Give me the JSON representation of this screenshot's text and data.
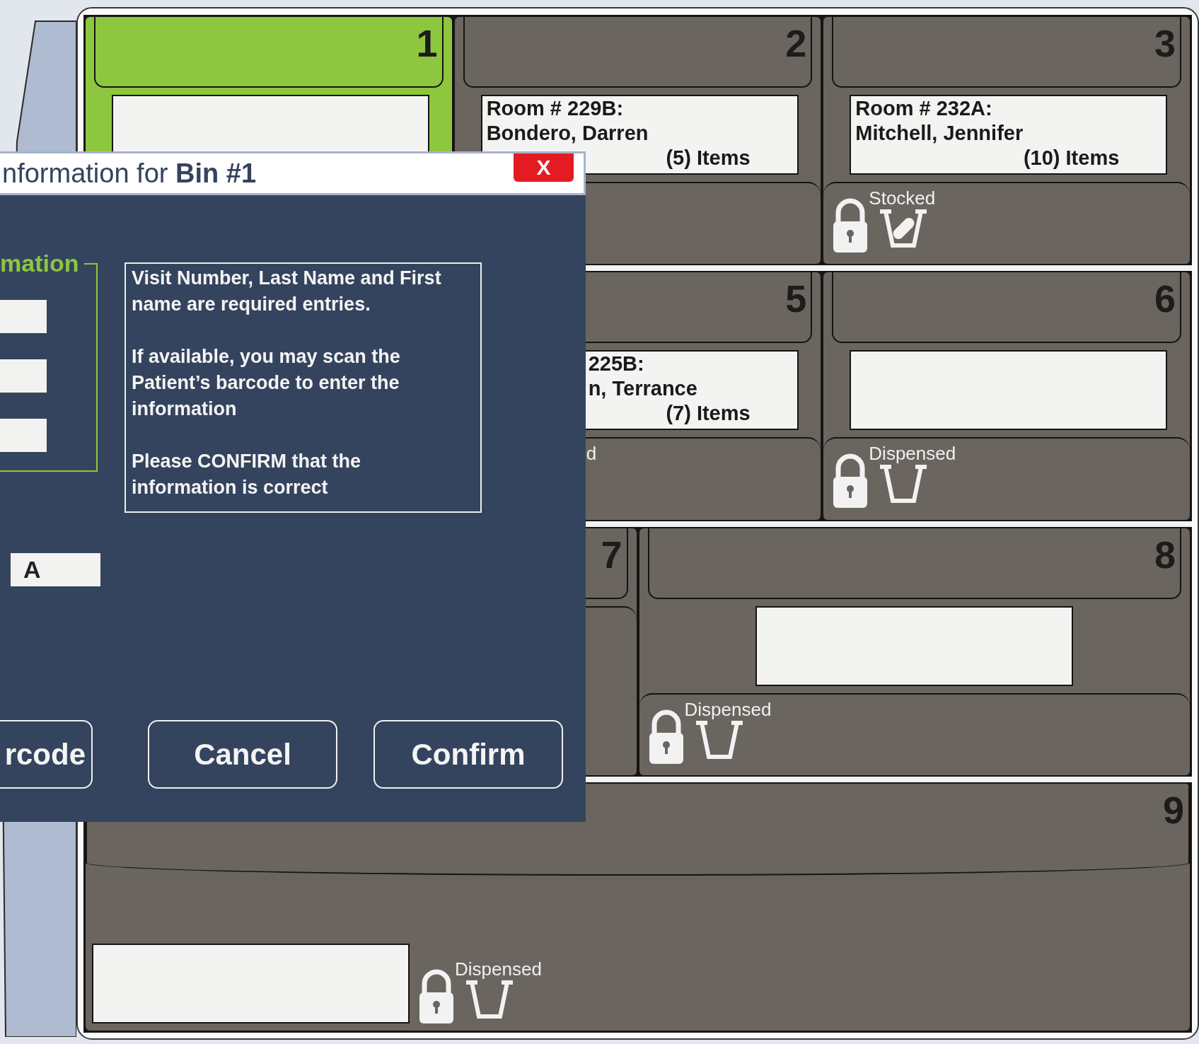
{
  "cabinet": {
    "rows": [
      {
        "kind": "thirds",
        "bins": [
          {
            "number": "1",
            "kind": "standard",
            "selected": true,
            "card": {
              "kind": "full"
            }
          },
          {
            "number": "2",
            "kind": "standard",
            "selected": false,
            "lip": true,
            "card": {
              "kind": "full",
              "lines": [
                {
                  "kind": "room",
                  "text": "Room # 229B:"
                },
                {
                  "kind": "name",
                  "text": "Bondero, Darren"
                },
                {
                  "kind": "count",
                  "text": "(5) Items"
                }
              ]
            }
          },
          {
            "number": "3",
            "kind": "standard",
            "selected": false,
            "lip": true,
            "card": {
              "kind": "full",
              "lines": [
                {
                  "kind": "room",
                  "text": "Room # 232A:"
                },
                {
                  "kind": "name",
                  "text": "Mitchell, Jennifer"
                },
                {
                  "kind": "count",
                  "text": "(10) Items"
                }
              ]
            },
            "status": {
              "kind": "stocked",
              "text": "Stocked"
            }
          }
        ]
      },
      {
        "kind": "thirds",
        "bins": [
          {
            "number": "5",
            "kind": "standard",
            "selected": false,
            "lip": true,
            "card": {
              "kind": "cut",
              "lines": [
                {
                  "kind": "room",
                  "text": "225B:"
                },
                {
                  "kind": "name",
                  "text": "n, Terrance"
                },
                {
                  "kind": "count",
                  "text": "(7) Items"
                }
              ]
            },
            "status": {
              "kind": "partial",
              "text": "d"
            }
          },
          {
            "number": "6",
            "kind": "standard",
            "selected": false,
            "lip": true,
            "card": {
              "kind": "full"
            },
            "status": {
              "kind": "dispensed",
              "text": "Dispensed"
            }
          }
        ]
      },
      {
        "kind": "halves",
        "bins": [
          {
            "number": "7",
            "kind": "half",
            "selected": false,
            "lip": true
          },
          {
            "number": "8",
            "kind": "half",
            "selected": false,
            "lip": true,
            "card": {
              "kind": "full"
            },
            "status": {
              "kind": "dispensed",
              "text": "Dispensed"
            }
          }
        ]
      },
      {
        "kind": "whole",
        "bins": [
          {
            "number": "9",
            "kind": "whole",
            "selected": false,
            "card": {
              "kind": "full"
            },
            "status": {
              "kind": "dispensed",
              "text": "Dispensed"
            }
          }
        ]
      }
    ]
  },
  "dialog": {
    "title": "nformation for **Bin #1**",
    "close_label": "X",
    "group_legend": "mation",
    "info": [
      "Visit Number, Last Name and First name are required entries.",
      "If available, you may scan the Patient’s barcode to enter the information",
      "Please CONFIRM that the information is correct"
    ],
    "field_value": "A",
    "buttons": [
      {
        "kind": "cut",
        "label": "rcode"
      },
      {
        "kind": "full",
        "label": "Cancel"
      },
      {
        "kind": "full",
        "label": "Confirm"
      }
    ]
  }
}
